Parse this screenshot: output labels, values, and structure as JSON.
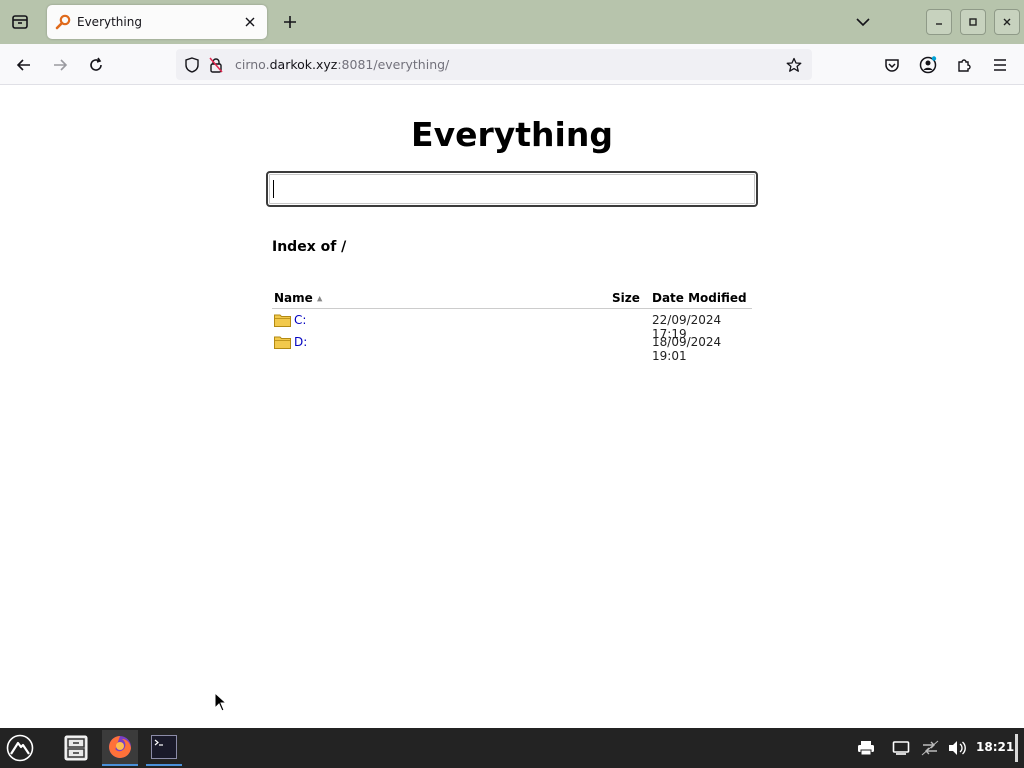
{
  "browser": {
    "tab": {
      "title": "Everything"
    },
    "url": {
      "prefix": "cirno.",
      "host": "darkok.xyz",
      "suffix": ":8081/everything/"
    }
  },
  "page": {
    "title": "Everything",
    "search": {
      "value": "",
      "placeholder": ""
    },
    "index_heading": "Index of /",
    "columns": {
      "name": "Name",
      "sort_indicator": "▲",
      "size": "Size",
      "date": "Date Modified"
    },
    "rows": [
      {
        "name": "C:",
        "size": "",
        "date": "22/09/2024 17:19"
      },
      {
        "name": "D:",
        "size": "",
        "date": "18/09/2024 19:01"
      }
    ]
  },
  "taskbar": {
    "clock": "18:21"
  },
  "colors": {
    "tabbar_bg": "#b7c4ac",
    "link": "#0000c0",
    "folder": "#f2c94c",
    "taskbar_bg": "#232323"
  }
}
